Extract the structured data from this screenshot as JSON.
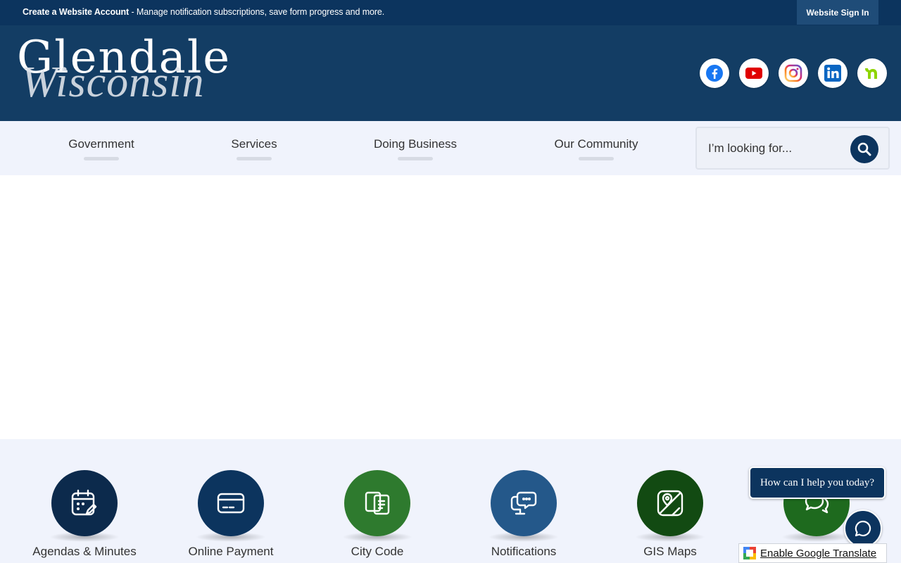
{
  "topbar": {
    "account_link": "Create a Website Account",
    "account_desc": " - Manage notification subscriptions, save form progress and more.",
    "sign_in": "Website Sign In"
  },
  "header": {
    "logo_top": "Glendale",
    "logo_bottom": "Wisconsin",
    "socials": [
      "facebook-icon",
      "youtube-icon",
      "instagram-icon",
      "linkedin-icon",
      "nextdoor-icon"
    ]
  },
  "nav": {
    "items": [
      {
        "label": "Government"
      },
      {
        "label": "Services"
      },
      {
        "label": "Doing Business"
      },
      {
        "label": "Our Community"
      }
    ]
  },
  "search": {
    "placeholder": "I’m looking for..."
  },
  "quick_links": [
    {
      "label": "Agendas & Minutes",
      "color": "#0c2a4c",
      "icon": "calendar-edit-icon"
    },
    {
      "label": "Online Payment",
      "color": "#0c345e",
      "icon": "credit-card-icon"
    },
    {
      "label": "City Code",
      "color": "#2e7a2e",
      "icon": "document-stack-icon"
    },
    {
      "label": "Notifications",
      "color": "#24588a",
      "icon": "message-monitor-icon"
    },
    {
      "label": "GIS Maps",
      "color": "#124a12",
      "icon": "map-pin-icon"
    },
    {
      "label": "",
      "color": "#1e6a1e",
      "icon": "chat-bubbles-icon"
    }
  ],
  "chat": {
    "prompt": "How can I help you today?"
  },
  "translate": {
    "label": "Enable Google Translate"
  },
  "colors": {
    "topbar": "#0c345e",
    "header": "#133d64",
    "nav_bg": "#f0f3fc"
  }
}
